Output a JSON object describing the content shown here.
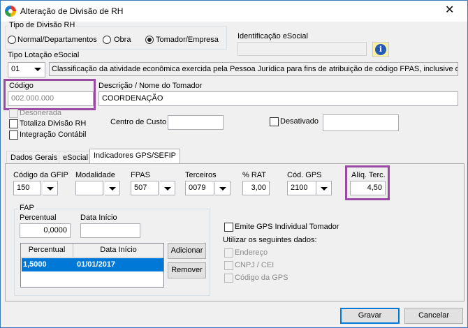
{
  "window": {
    "title": "Alteração de Divisão de RH"
  },
  "tipo_divisao": {
    "label": "Tipo de Divisão RH",
    "options": [
      {
        "label": "Normal/Departamentos",
        "selected": false
      },
      {
        "label": "Obra",
        "selected": false
      },
      {
        "label": "Tomador/Empresa",
        "selected": true
      }
    ]
  },
  "identificacao": {
    "label": "Identificação eSocial",
    "value": ""
  },
  "lotacao": {
    "label": "Tipo Lotação eSocial",
    "code": "01",
    "description": "Classificação da atividade econômica exercida pela Pessoa Jurídica para fins de atribuição de código FPAS, inclusive obras"
  },
  "codigo": {
    "label": "Código",
    "value": "002.000.000"
  },
  "descricao": {
    "label": "Descrição / Nome do Tomador",
    "value": "COORDENAÇÃO"
  },
  "checks": {
    "desonerada": "Desonerada",
    "totaliza": "Totaliza Divisão RH",
    "integracao": "Integração Contábil",
    "desativado": "Desativado"
  },
  "centro_custo": {
    "label": "Centro de Custo",
    "value": ""
  },
  "desativado_value": "",
  "tabs": [
    "Dados Gerais",
    "eSocial",
    "Indicadores GPS/SEFIP"
  ],
  "gps": {
    "codigo_gfip": {
      "label": "Código da GFIP",
      "value": "150"
    },
    "modalidade": {
      "label": "Modalidade",
      "value": ""
    },
    "fpas": {
      "label": "FPAS",
      "value": "507"
    },
    "terceiros": {
      "label": "Terceiros",
      "value": "0079"
    },
    "rat": {
      "label": "% RAT",
      "value": "3,00"
    },
    "cod_gps": {
      "label": "Cód. GPS",
      "value": "2100"
    },
    "aliq_terc": {
      "label": "Alíq. Terc.",
      "value": "4,50"
    }
  },
  "fap": {
    "title": "FAP",
    "percentual_label": "Percentual",
    "percentual_value": "0,0000",
    "data_inicio_label": "Data Início",
    "data_inicio_value": "",
    "columns": [
      "Percentual",
      "Data Início"
    ],
    "rows": [
      {
        "percentual": "1,5000",
        "data_inicio": "01/01/2017"
      }
    ],
    "add_button": "Adicionar",
    "remove_button": "Remover"
  },
  "emite_gps": "Emite GPS Individual Tomador",
  "utilizar": {
    "label": "Utilizar os seguintes dados:",
    "options": [
      "Endereço",
      "CNPJ / CEI",
      "Código da GPS"
    ]
  },
  "footer": {
    "gravar": "Gravar",
    "cancelar": "Cancelar"
  },
  "colors": {
    "highlight": "#9b4aa3",
    "selection": "#0078d7",
    "window_border": "#3c78b4"
  }
}
